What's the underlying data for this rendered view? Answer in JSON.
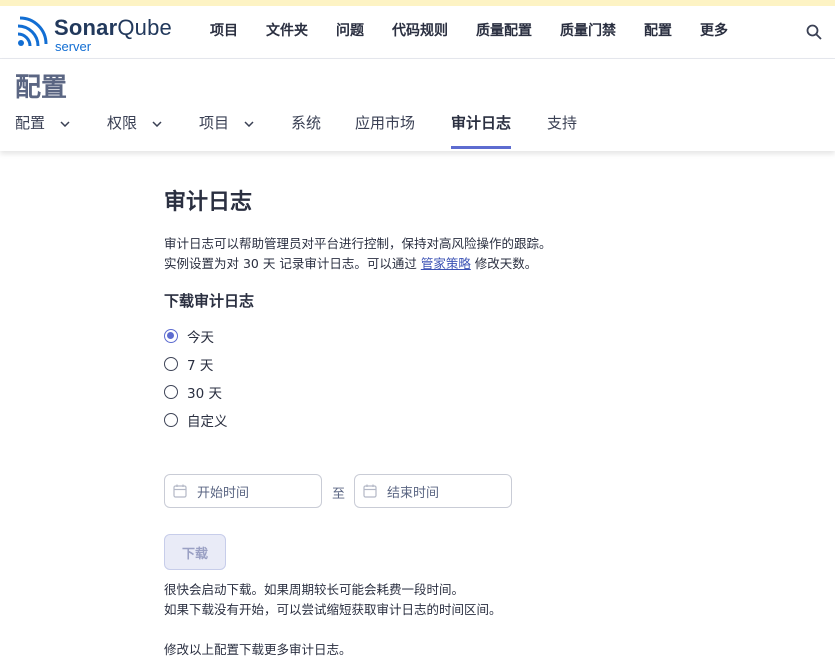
{
  "brand": {
    "name_sonar": "Sonar",
    "name_qube": "Qube",
    "edition": "server",
    "color": "#126ed3"
  },
  "topnav": [
    "项目",
    "文件夹",
    "问题",
    "代码规则",
    "质量配置",
    "质量门禁",
    "配置",
    "更多"
  ],
  "page": {
    "title": "配置",
    "tabs": [
      {
        "label": "配置",
        "dropdown": true
      },
      {
        "label": "权限",
        "dropdown": true
      },
      {
        "label": "项目",
        "dropdown": true
      },
      {
        "label": "系统",
        "dropdown": false
      },
      {
        "label": "应用市场",
        "dropdown": false
      },
      {
        "label": "审计日志",
        "dropdown": false,
        "active": true
      },
      {
        "label": "支持",
        "dropdown": false
      }
    ]
  },
  "audit": {
    "heading": "审计日志",
    "desc_line1": "审计日志可以帮助管理员对平台进行控制，保持对高风险操作的跟踪。",
    "desc_line2_pre": "实例设置为对 30 天 记录审计日志。可以通过 ",
    "desc_link": "管家策略",
    "desc_line2_post": " 修改天数。",
    "download_heading": "下载审计日志",
    "options": [
      {
        "label": "今天",
        "checked": true
      },
      {
        "label": "7 天",
        "checked": false
      },
      {
        "label": "30 天",
        "checked": false
      },
      {
        "label": "自定义",
        "checked": false
      }
    ],
    "start_placeholder": "开始时间",
    "to_label": "至",
    "end_placeholder": "结束时间",
    "download_button": "下载",
    "note_line1": "很快会启动下载。如果周期较长可能会耗费一段时间。",
    "note_line2": "如果下载没有开始，可以尝试缩短获取审计日志的时间区间。",
    "note_line3": "修改以上配置下载更多审计日志。"
  },
  "accent_color": "#5d6cd0"
}
